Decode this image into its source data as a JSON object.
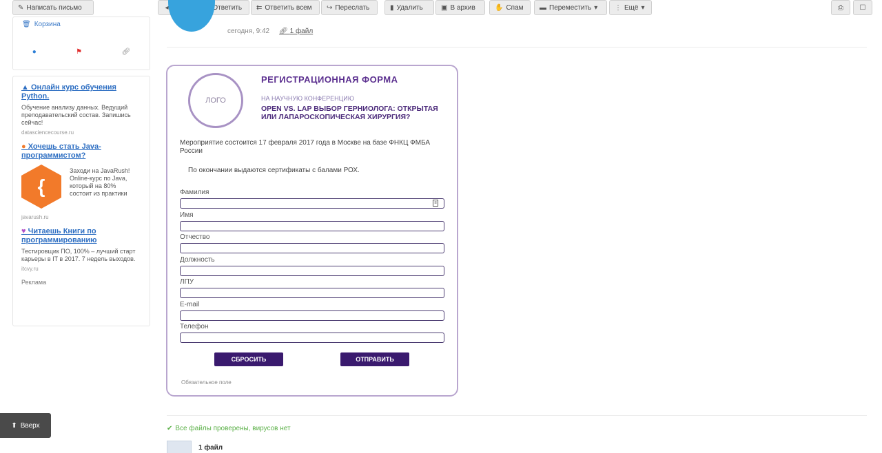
{
  "toolbar": {
    "compose": "Написать письмо",
    "prev": "◂",
    "next": "▾",
    "reply": "Ответить",
    "reply_all": "Ответить всем",
    "forward": "Переслать",
    "delete": "Удалить",
    "archive": "В архив",
    "spam": "Спам",
    "move": "Переместить",
    "more": "Ещё"
  },
  "sidebar": {
    "trash": "Корзина"
  },
  "ads": {
    "items": [
      {
        "title": "Онлайн курс обучения Python.",
        "text": "Обучение анализу данных. Ведущий преподавательский состав. Запишись сейчас!",
        "src": "datasciencecourse.ru"
      },
      {
        "title": "Хочешь стать Java-программистом?",
        "text": "Заходи на JavaRush! Online-курс по Java, который на 80% состоит из практики",
        "src": "javarush.ru"
      },
      {
        "title": "Читаешь Книги по программированию",
        "text": "Тестировщик ПО, 100% – лучший старт карьеры в IT в 2017. 7 недель выходов.",
        "src": "itcvy.ru"
      }
    ],
    "label": "Реклама"
  },
  "up_button": "Вверх",
  "message": {
    "time": "сегодня, 9:42",
    "attachments": "1 файл"
  },
  "form": {
    "logo": "ЛОГО",
    "title": "РЕГИСТРАЦИОННАЯ ФОРМА",
    "subtitle": "НА НАУЧНУЮ КОНФЕРЕНЦИЮ",
    "heading": "OPEN VS. LAP ВЫБОР ГЕРНИОЛОГА: ОТКРЫТАЯ ИЛИ ЛАПАРОСКОПИЧЕСКАЯ ХИРУРГИЯ?",
    "info": "Мероприятие состоится 17 февраля 2017 года в Москве на базе ФНКЦ ФМБА России",
    "certificates": "По окончании выдаются сертификаты с балами РОХ.",
    "fields": {
      "surname": "Фамилия",
      "name": "Имя",
      "patronymic": "Отчество",
      "position": "Должность",
      "lpu": "ЛПУ",
      "email": "E-mail",
      "phone": "Телефон"
    },
    "reset": "СБРОСИТЬ",
    "submit": "ОТПРАВИТЬ",
    "required_note": "Обязательное поле"
  },
  "footer": {
    "virus_check": "Все файлы проверены, вирусов нет",
    "files_count": "1 файл"
  }
}
